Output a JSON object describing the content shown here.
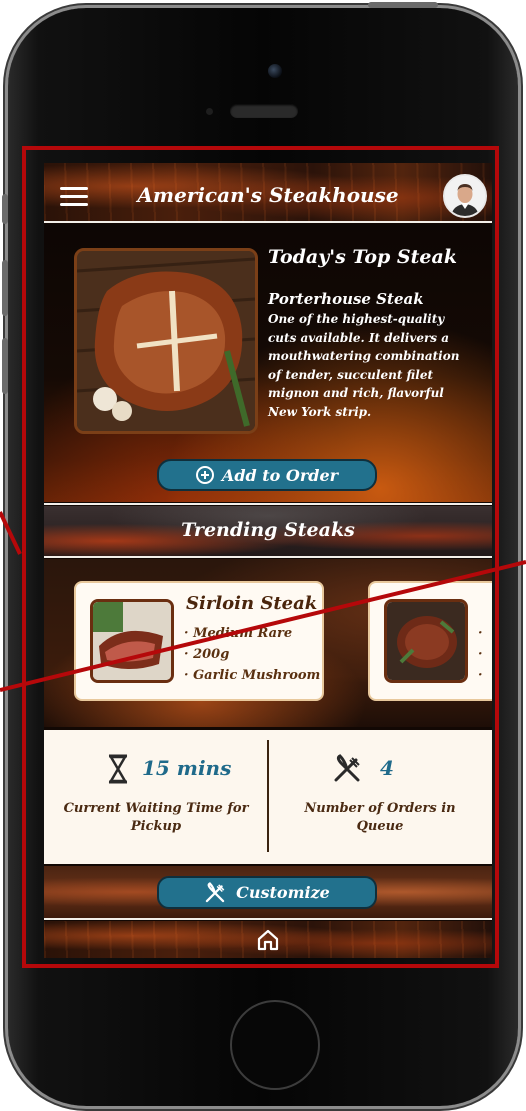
{
  "header": {
    "title": "American's Steakhouse"
  },
  "top_steak": {
    "heading": "Today's Top Steak",
    "name": "Porterhouse Steak",
    "description": "One of the highest-quality cuts available. It delivers a mouthwatering combination of tender, succulent filet mignon and rich, flavorful New York strip.",
    "add_button": "Add to Order"
  },
  "trending": {
    "heading": "Trending Steaks",
    "cards": [
      {
        "title": "Sirloin Steak",
        "details": [
          "Medium Rare",
          "200g",
          "Garlic Mushroom"
        ]
      },
      {
        "title": "",
        "details": [
          "",
          "",
          ""
        ]
      }
    ]
  },
  "stats": {
    "wait_value": "15 mins",
    "wait_label": "Current Waiting Time for Pickup",
    "orders_value": "4",
    "orders_label": "Number of Orders in Queue"
  },
  "customize": {
    "label": "Customize"
  },
  "colors": {
    "frame_red": "#b5080a",
    "button_teal": "#22718d",
    "stat_blue": "#1f6a8a",
    "card_bg": "#fffaf3",
    "stats_bg": "#fdf7ee"
  },
  "icons": {
    "menu": "hamburger-icon",
    "add": "plus-circle-icon",
    "wait": "hourglass-icon",
    "orders": "fork-knife-icon",
    "customize": "fork-knife-icon",
    "home": "home-icon"
  }
}
